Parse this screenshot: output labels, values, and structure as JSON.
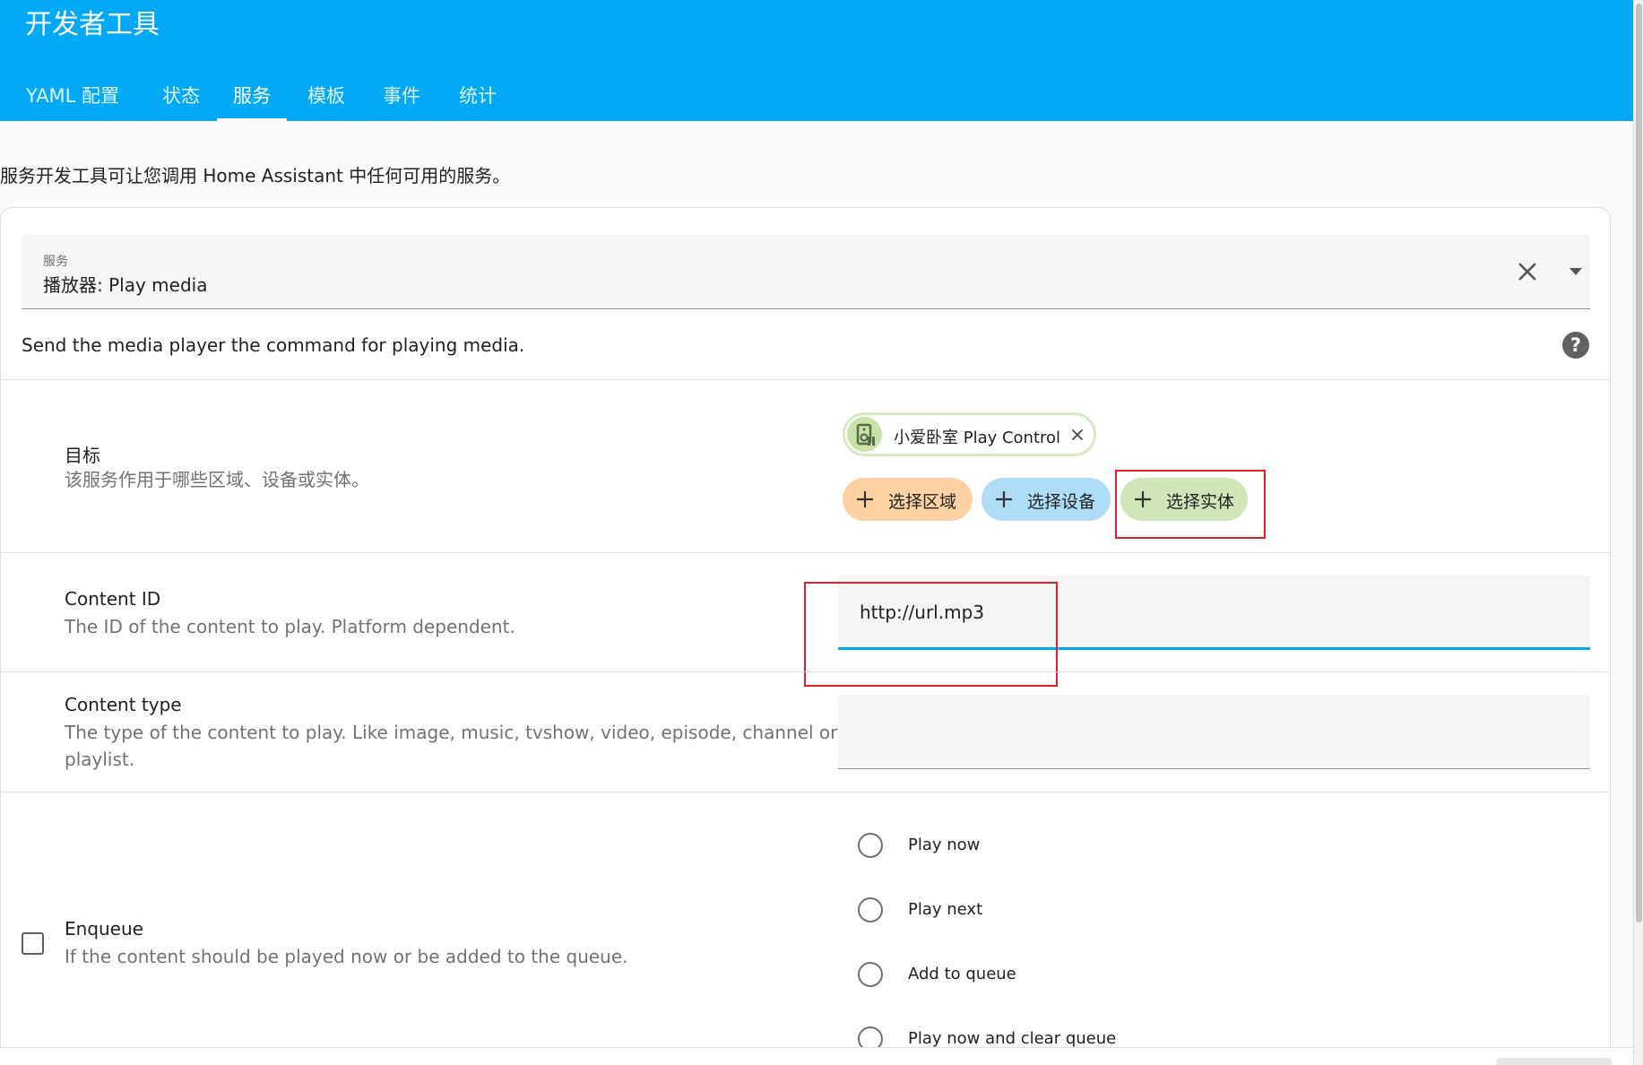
{
  "header": {
    "title": "开发者工具",
    "tabs": [
      {
        "label": "YAML 配置",
        "active": false
      },
      {
        "label": "状态",
        "active": false
      },
      {
        "label": "服务",
        "active": true
      },
      {
        "label": "模板",
        "active": false
      },
      {
        "label": "事件",
        "active": false
      },
      {
        "label": "统计",
        "active": false
      }
    ]
  },
  "intro": "服务开发工具可让您调用 Home Assistant 中任何可用的服务。",
  "service": {
    "label": "服务",
    "value": "播放器: Play media",
    "description": "Send the media player the command for playing media."
  },
  "target": {
    "title": "目标",
    "description": "该服务作用于哪些区域、设备或实体。",
    "chip_label": "小爱卧室 Play Control",
    "pick_area": "选择区域",
    "pick_device": "选择设备",
    "pick_entity": "选择实体"
  },
  "content_id": {
    "title": "Content ID",
    "description": "The ID of the content to play. Platform dependent.",
    "value": "http://url.mp3"
  },
  "content_type": {
    "title": "Content type",
    "description_line1": "The type of the content to play. Like image, music, tvshow, video, episode, channel or",
    "description_line2": "playlist.",
    "value": ""
  },
  "enqueue": {
    "title": "Enqueue",
    "description": "If the content should be played now or be added to the queue.",
    "checked": false,
    "options": [
      "Play now",
      "Play next",
      "Add to queue",
      "Play now and clear queue"
    ]
  },
  "colors": {
    "header": "#03a9f4",
    "highlight": "#e0202a",
    "chip_area": "#fcd2a3",
    "chip_device": "#afdcf6",
    "chip_entity": "#d0e6b9"
  }
}
